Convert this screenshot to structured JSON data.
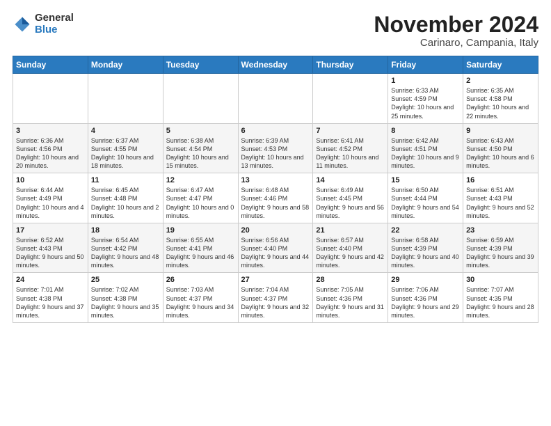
{
  "header": {
    "logo_line1": "General",
    "logo_line2": "Blue",
    "title": "November 2024",
    "subtitle": "Carinaro, Campania, Italy"
  },
  "weekdays": [
    "Sunday",
    "Monday",
    "Tuesday",
    "Wednesday",
    "Thursday",
    "Friday",
    "Saturday"
  ],
  "weeks": [
    [
      {
        "day": "",
        "detail": ""
      },
      {
        "day": "",
        "detail": ""
      },
      {
        "day": "",
        "detail": ""
      },
      {
        "day": "",
        "detail": ""
      },
      {
        "day": "",
        "detail": ""
      },
      {
        "day": "1",
        "detail": "Sunrise: 6:33 AM\nSunset: 4:59 PM\nDaylight: 10 hours and 25 minutes."
      },
      {
        "day": "2",
        "detail": "Sunrise: 6:35 AM\nSunset: 4:58 PM\nDaylight: 10 hours and 22 minutes."
      }
    ],
    [
      {
        "day": "3",
        "detail": "Sunrise: 6:36 AM\nSunset: 4:56 PM\nDaylight: 10 hours and 20 minutes."
      },
      {
        "day": "4",
        "detail": "Sunrise: 6:37 AM\nSunset: 4:55 PM\nDaylight: 10 hours and 18 minutes."
      },
      {
        "day": "5",
        "detail": "Sunrise: 6:38 AM\nSunset: 4:54 PM\nDaylight: 10 hours and 15 minutes."
      },
      {
        "day": "6",
        "detail": "Sunrise: 6:39 AM\nSunset: 4:53 PM\nDaylight: 10 hours and 13 minutes."
      },
      {
        "day": "7",
        "detail": "Sunrise: 6:41 AM\nSunset: 4:52 PM\nDaylight: 10 hours and 11 minutes."
      },
      {
        "day": "8",
        "detail": "Sunrise: 6:42 AM\nSunset: 4:51 PM\nDaylight: 10 hours and 9 minutes."
      },
      {
        "day": "9",
        "detail": "Sunrise: 6:43 AM\nSunset: 4:50 PM\nDaylight: 10 hours and 6 minutes."
      }
    ],
    [
      {
        "day": "10",
        "detail": "Sunrise: 6:44 AM\nSunset: 4:49 PM\nDaylight: 10 hours and 4 minutes."
      },
      {
        "day": "11",
        "detail": "Sunrise: 6:45 AM\nSunset: 4:48 PM\nDaylight: 10 hours and 2 minutes."
      },
      {
        "day": "12",
        "detail": "Sunrise: 6:47 AM\nSunset: 4:47 PM\nDaylight: 10 hours and 0 minutes."
      },
      {
        "day": "13",
        "detail": "Sunrise: 6:48 AM\nSunset: 4:46 PM\nDaylight: 9 hours and 58 minutes."
      },
      {
        "day": "14",
        "detail": "Sunrise: 6:49 AM\nSunset: 4:45 PM\nDaylight: 9 hours and 56 minutes."
      },
      {
        "day": "15",
        "detail": "Sunrise: 6:50 AM\nSunset: 4:44 PM\nDaylight: 9 hours and 54 minutes."
      },
      {
        "day": "16",
        "detail": "Sunrise: 6:51 AM\nSunset: 4:43 PM\nDaylight: 9 hours and 52 minutes."
      }
    ],
    [
      {
        "day": "17",
        "detail": "Sunrise: 6:52 AM\nSunset: 4:43 PM\nDaylight: 9 hours and 50 minutes."
      },
      {
        "day": "18",
        "detail": "Sunrise: 6:54 AM\nSunset: 4:42 PM\nDaylight: 9 hours and 48 minutes."
      },
      {
        "day": "19",
        "detail": "Sunrise: 6:55 AM\nSunset: 4:41 PM\nDaylight: 9 hours and 46 minutes."
      },
      {
        "day": "20",
        "detail": "Sunrise: 6:56 AM\nSunset: 4:40 PM\nDaylight: 9 hours and 44 minutes."
      },
      {
        "day": "21",
        "detail": "Sunrise: 6:57 AM\nSunset: 4:40 PM\nDaylight: 9 hours and 42 minutes."
      },
      {
        "day": "22",
        "detail": "Sunrise: 6:58 AM\nSunset: 4:39 PM\nDaylight: 9 hours and 40 minutes."
      },
      {
        "day": "23",
        "detail": "Sunrise: 6:59 AM\nSunset: 4:39 PM\nDaylight: 9 hours and 39 minutes."
      }
    ],
    [
      {
        "day": "24",
        "detail": "Sunrise: 7:01 AM\nSunset: 4:38 PM\nDaylight: 9 hours and 37 minutes."
      },
      {
        "day": "25",
        "detail": "Sunrise: 7:02 AM\nSunset: 4:38 PM\nDaylight: 9 hours and 35 minutes."
      },
      {
        "day": "26",
        "detail": "Sunrise: 7:03 AM\nSunset: 4:37 PM\nDaylight: 9 hours and 34 minutes."
      },
      {
        "day": "27",
        "detail": "Sunrise: 7:04 AM\nSunset: 4:37 PM\nDaylight: 9 hours and 32 minutes."
      },
      {
        "day": "28",
        "detail": "Sunrise: 7:05 AM\nSunset: 4:36 PM\nDaylight: 9 hours and 31 minutes."
      },
      {
        "day": "29",
        "detail": "Sunrise: 7:06 AM\nSunset: 4:36 PM\nDaylight: 9 hours and 29 minutes."
      },
      {
        "day": "30",
        "detail": "Sunrise: 7:07 AM\nSunset: 4:35 PM\nDaylight: 9 hours and 28 minutes."
      }
    ]
  ]
}
